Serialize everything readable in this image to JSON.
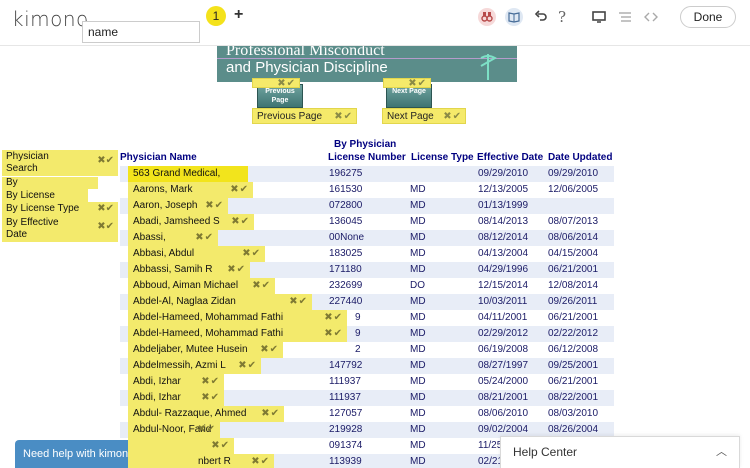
{
  "toolbar": {
    "brand": "kimono",
    "badge": "1",
    "add": "+",
    "input_value": "name",
    "done": "Done",
    "icons": [
      "binoculars-icon",
      "book-icon",
      "undo-icon",
      "help-icon",
      "monitor-icon",
      "list-icon",
      "code-icon"
    ]
  },
  "banner": {
    "line1": "Professional Misconduct",
    "line2": "and Physician Discipline"
  },
  "nav": {
    "prev_image": "Previous Page",
    "next_image": "Next Page",
    "prev_tag": "Previous Page",
    "next_tag": "Next Page"
  },
  "table": {
    "caption": "By Physician",
    "headers": [
      "Physician Name",
      "License Number",
      "License Type",
      "Effective Date",
      "Date Updated"
    ],
    "rows": [
      {
        "name": "563 Grand Medical,",
        "license": "196275",
        "type": "",
        "effective": "09/29/2010",
        "updated": "09/29/2010"
      },
      {
        "name": "Aarons, Mark",
        "license": "161530",
        "type": "MD",
        "effective": "12/13/2005",
        "updated": "12/06/2005"
      },
      {
        "name": "Aaron, Joseph",
        "license": "072800",
        "type": "MD",
        "effective": "01/13/1999",
        "updated": ""
      },
      {
        "name": "Abadi, Jamsheed S",
        "license": "136045",
        "type": "MD",
        "effective": "08/14/2013",
        "updated": "08/07/2013"
      },
      {
        "name": "Abassi,",
        "license": "00None",
        "type": "MD",
        "effective": "08/12/2014",
        "updated": "08/06/2014"
      },
      {
        "name": "Abbasi, Abdul",
        "license": "183025",
        "type": "MD",
        "effective": "04/13/2004",
        "updated": "04/15/2004"
      },
      {
        "name": "Abbassi, Samih R",
        "license": "171180",
        "type": "MD",
        "effective": "04/29/1996",
        "updated": "06/21/2001"
      },
      {
        "name": "Abboud, Aiman Michael",
        "license": "232699",
        "type": "DO",
        "effective": "12/15/2014",
        "updated": "12/08/2014"
      },
      {
        "name": "Abdel-Al, Naglaa Zidan",
        "license": "227440",
        "type": "MD",
        "effective": "10/03/2011",
        "updated": "09/26/2011"
      },
      {
        "name": "Abdel-Hameed, Mohammad Fathi",
        "license": "9",
        "type": "MD",
        "effective": "04/11/2001",
        "updated": "06/21/2001"
      },
      {
        "name": "Abdel-Hameed, Mohammad Fathi",
        "license": "9",
        "type": "MD",
        "effective": "02/29/2012",
        "updated": "02/22/2012"
      },
      {
        "name": "Abdeljaber, Mutee Husein",
        "license": "2",
        "type": "MD",
        "effective": "06/19/2008",
        "updated": "06/12/2008"
      },
      {
        "name": "Abdelmessih, Azmi L",
        "license": "147792",
        "type": "MD",
        "effective": "08/27/1997",
        "updated": "09/25/2001"
      },
      {
        "name": "Abdi, Izhar",
        "license": "111937",
        "type": "MD",
        "effective": "05/24/2000",
        "updated": "06/21/2001"
      },
      {
        "name": "Abdi, Izhar",
        "license": "111937",
        "type": "MD",
        "effective": "08/21/2001",
        "updated": "08/22/2001"
      },
      {
        "name": "Abdul- Razzaque, Ahmed",
        "license": "127057",
        "type": "MD",
        "effective": "08/06/2010",
        "updated": "08/03/2010"
      },
      {
        "name": "Abdul-Noor, Farid",
        "license": "219928",
        "type": "MD",
        "effective": "09/02/2004",
        "updated": "08/26/2004"
      },
      {
        "name": "",
        "license": "091374",
        "type": "MD",
        "effective": "11/25",
        "updated": ""
      },
      {
        "name": "nbert R",
        "license": "113939",
        "type": "MD",
        "effective": "02/21",
        "updated": ""
      }
    ]
  },
  "sidebar": {
    "items": [
      "Physician Search",
      "By",
      "By License",
      "By License Type",
      "By Effective Date"
    ]
  },
  "help": {
    "left": "Need help with kimono?",
    "right": "Help Center"
  },
  "colors": {
    "tag_yellow": "#f3ea6c",
    "header_navy": "#000080",
    "banner_teal": "#5b8d8a",
    "help_blue": "#4a8dc4"
  }
}
